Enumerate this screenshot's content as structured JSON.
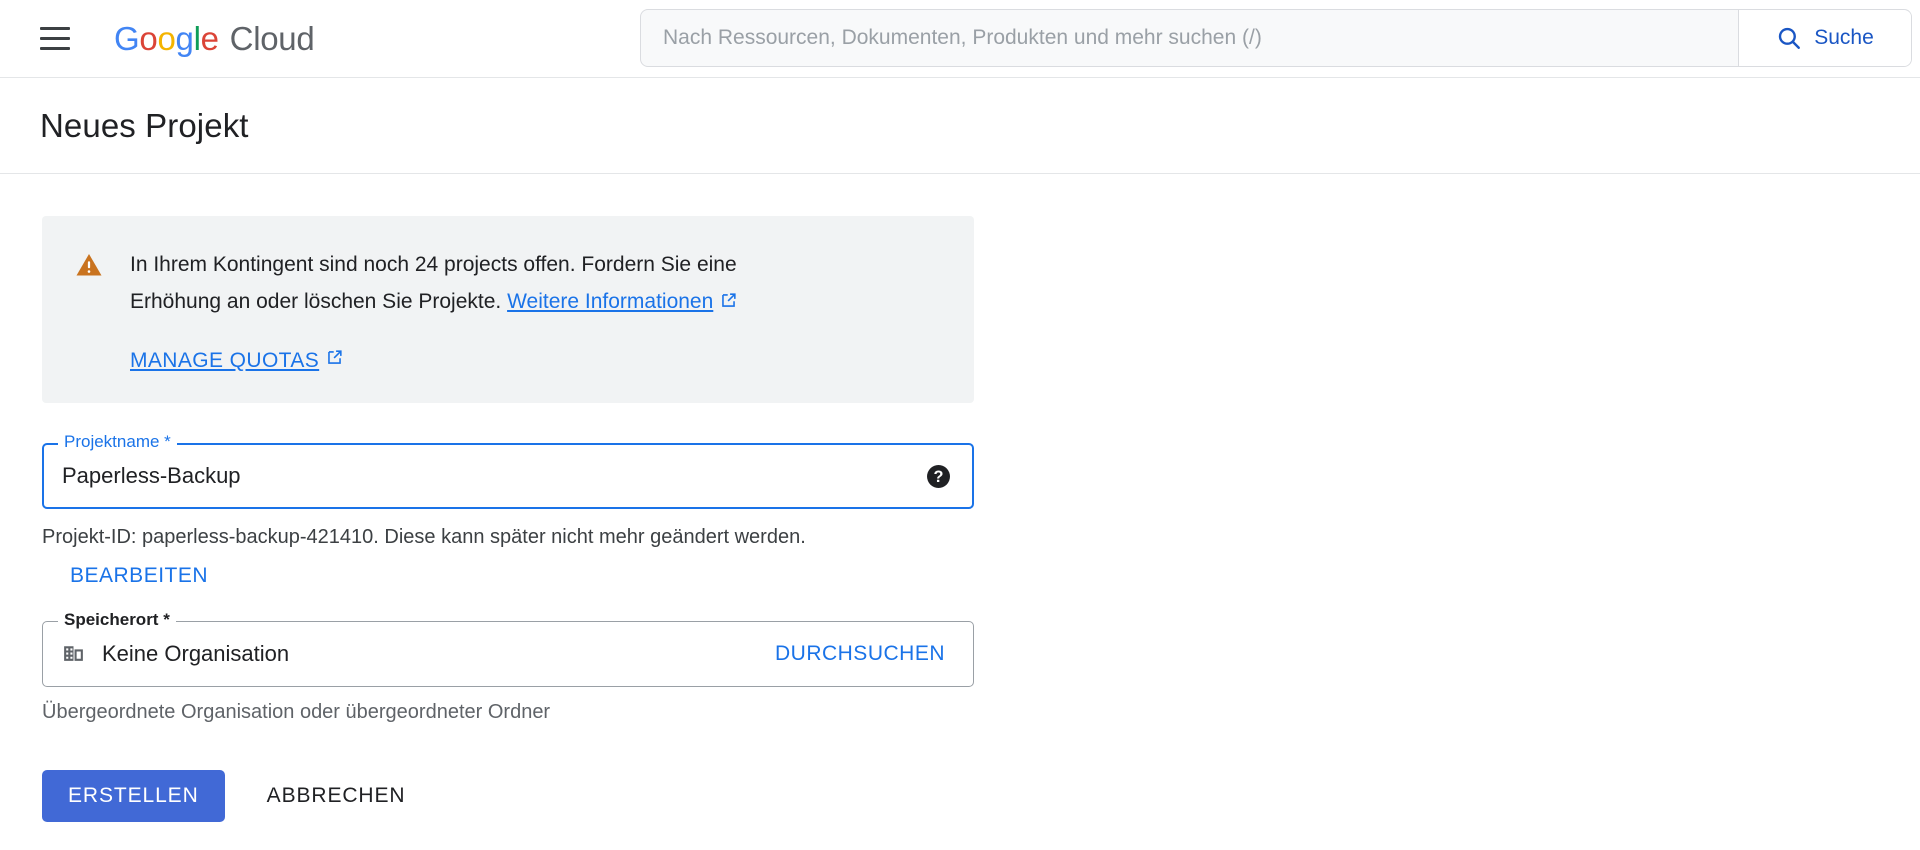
{
  "topbar": {
    "menu_icon": "hamburger-menu-icon",
    "brand": {
      "g1": "G",
      "o1": "o",
      "o2": "o",
      "g2": "g",
      "l1": "l",
      "e1": "e",
      "cloud": "Cloud"
    },
    "search": {
      "placeholder": "Nach Ressourcen, Dokumenten, Produkten und mehr suchen (/)",
      "value": "",
      "button_label": "Suche",
      "button_icon": "search-icon"
    }
  },
  "page": {
    "title": "Neues Projekt"
  },
  "banner": {
    "icon": "warning-triangle-icon",
    "icon_color": "#c9731f",
    "text_part1": "In Ihrem Kontingent sind noch 24 projects offen. Fordern Sie eine Erhöhung an oder löschen Sie Projekte. ",
    "link_label": "Weitere Informationen",
    "link_icon": "external-link-icon",
    "action_label": "MANAGE QUOTAS",
    "action_icon": "external-link-icon",
    "background": "#f1f3f4"
  },
  "project_name_field": {
    "legend": "Projektname *",
    "value": "Paperless-Backup",
    "placeholder": "",
    "help_icon": "help-circle-icon",
    "helper_text": "Projekt-ID: paperless-backup-421410. Diese kann später nicht mehr geändert werden.",
    "edit_label": "BEARBEITEN",
    "accent_color": "#1a73e8"
  },
  "location_field": {
    "legend": "Speicherort *",
    "icon": "organization-building-icon",
    "value": "Keine Organisation",
    "browse_label": "DURCHSUCHEN",
    "helper_text": "Übergeordnete Organisation oder übergeordneter Ordner"
  },
  "actions": {
    "create_label": "ERSTELLEN",
    "cancel_label": "ABBRECHEN",
    "primary_color": "#4169d6"
  }
}
